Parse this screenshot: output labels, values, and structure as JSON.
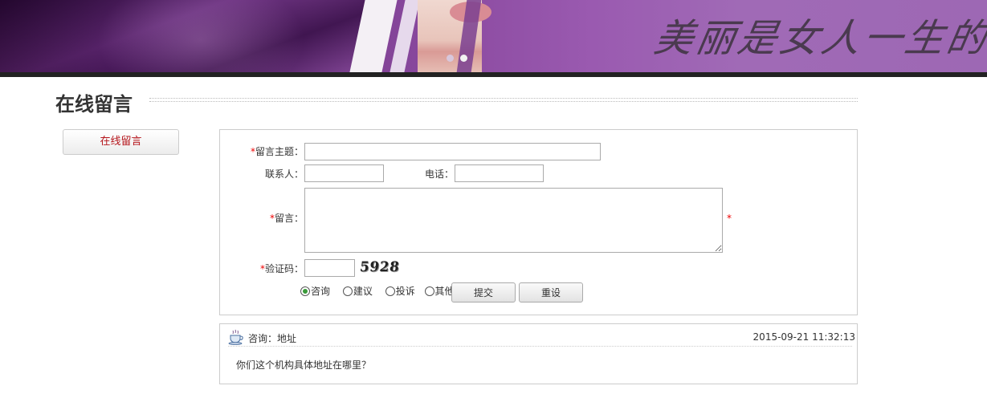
{
  "banner": {
    "calligraphy": "美丽是女人一生的事"
  },
  "page": {
    "title": "在线留言"
  },
  "sidebar": {
    "items": [
      {
        "label": "在线留言"
      }
    ]
  },
  "form": {
    "subject_label": "留言主题：",
    "contact_label": "联系人：",
    "phone_label": "电话：",
    "message_label": "留言：",
    "captcha_label": "验证码：",
    "required_mark": "*",
    "subject_value": "",
    "contact_value": "",
    "phone_value": "",
    "message_value": "",
    "captcha_value": "",
    "captcha_code": "5928",
    "types": [
      {
        "label": "咨询",
        "checked": true
      },
      {
        "label": "建议",
        "checked": false
      },
      {
        "label": "投诉",
        "checked": false
      },
      {
        "label": "其他",
        "checked": false
      }
    ],
    "submit_label": "提交",
    "reset_label": "重设"
  },
  "messages": [
    {
      "subject": "咨询：地址",
      "time": "2015-09-21 11:32:13",
      "body": "你们这个机构具体地址在哪里？"
    }
  ],
  "colors": {
    "accent": "#b5161c",
    "required": "#e00000",
    "banner_purple": "#7a3d8e"
  }
}
